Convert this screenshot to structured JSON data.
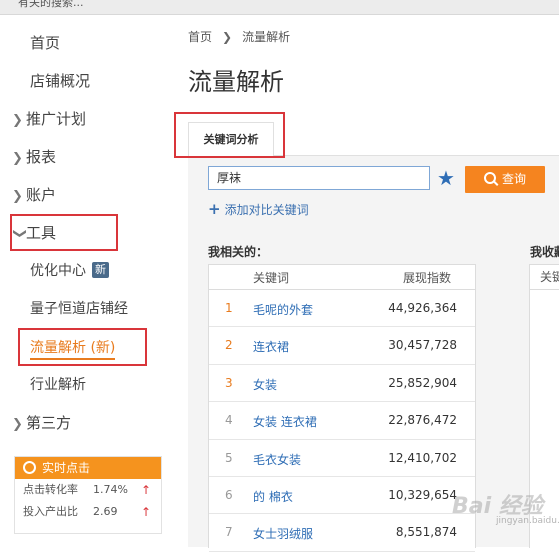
{
  "top_fragment": "有关的搜索...",
  "sidebar": {
    "home": "首页",
    "store_overview": "店铺概况",
    "promo_plan": "推广计划",
    "reports": "报表",
    "account": "账户",
    "tools": "工具",
    "tools_items": [
      {
        "label": "优化中心",
        "badge": "新"
      },
      {
        "label": "量子恒道店铺经"
      },
      {
        "label": "流量解析 (新)"
      },
      {
        "label": "行业解析"
      }
    ],
    "third_party": "第三方",
    "realtime": {
      "title": "实时点击",
      "rows": [
        {
          "label": "点击转化率",
          "value": "1.74%"
        },
        {
          "label": "投入产出比",
          "value": "2.69"
        }
      ]
    }
  },
  "breadcrumb": {
    "home": "首页",
    "current": "流量解析"
  },
  "page_title": "流量解析",
  "tab": "关键词分析",
  "search": {
    "value": "厚袜",
    "button": "查询"
  },
  "add_compare": "添加对比关键词",
  "related_title": "我相关的：",
  "favorites_title": "我收藏",
  "table": {
    "headers": {
      "keyword": "关键词",
      "impressions": "展现指数"
    },
    "rows": [
      {
        "rank": "1",
        "keyword": "毛呢的外套",
        "value": "44,926,364"
      },
      {
        "rank": "2",
        "keyword": "连衣裙",
        "value": "30,457,728"
      },
      {
        "rank": "3",
        "keyword": "女装",
        "value": "25,852,904"
      },
      {
        "rank": "4",
        "keyword": "女装 连衣裙",
        "value": "22,876,472"
      },
      {
        "rank": "5",
        "keyword": "毛衣女装",
        "value": "12,410,702"
      },
      {
        "rank": "6",
        "keyword": "的 棉衣",
        "value": "10,329,654"
      },
      {
        "rank": "7",
        "keyword": "女士羽绒服",
        "value": "8,551,874"
      }
    ]
  },
  "table2_header": "关键",
  "watermark": {
    "text": "Bai 经验",
    "sub": "jingyan.baidu.com"
  },
  "colors": {
    "accent": "#f5841f",
    "link": "#2e6db5",
    "highlight_box": "#d9353a"
  }
}
